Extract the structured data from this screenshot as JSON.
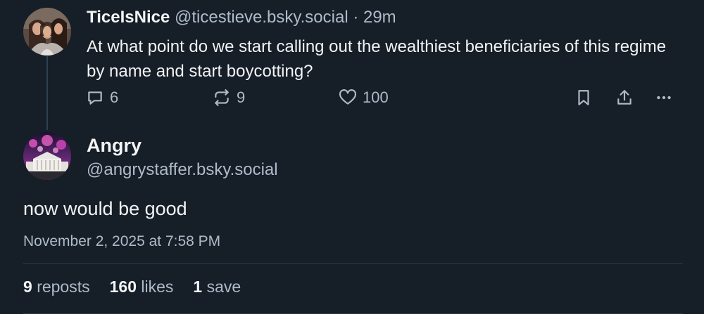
{
  "parent_post": {
    "author_name": "TiceIsNice",
    "author_handle": "@ticestieve.bsky.social",
    "separator": " · ",
    "time_ago": "29m",
    "text": "At what point do we start calling out the wealthiest beneficiaries of this regime by name and start boycotting?",
    "actions": {
      "reply_count": "6",
      "repost_count": "9",
      "like_count": "100"
    },
    "icons": [
      "reply-icon",
      "repost-icon",
      "heart-icon",
      "bookmark-icon",
      "share-icon",
      "more-icon"
    ]
  },
  "focused_post": {
    "author_name": "Angry",
    "author_handle": "@angrystaffer.bsky.social",
    "text": "now would be good",
    "timestamp": "November 2, 2025 at 7:58 PM",
    "stats": {
      "reposts_count": "9",
      "reposts_label": "reposts",
      "likes_count": "160",
      "likes_label": "likes",
      "saves_count": "1",
      "saves_label": "save"
    }
  },
  "colors": {
    "background": "#161e27",
    "text_primary": "#f1f3f5",
    "text_muted": "#aebbc9",
    "divider": "#2a3845",
    "thread_line": "#2e4052"
  }
}
